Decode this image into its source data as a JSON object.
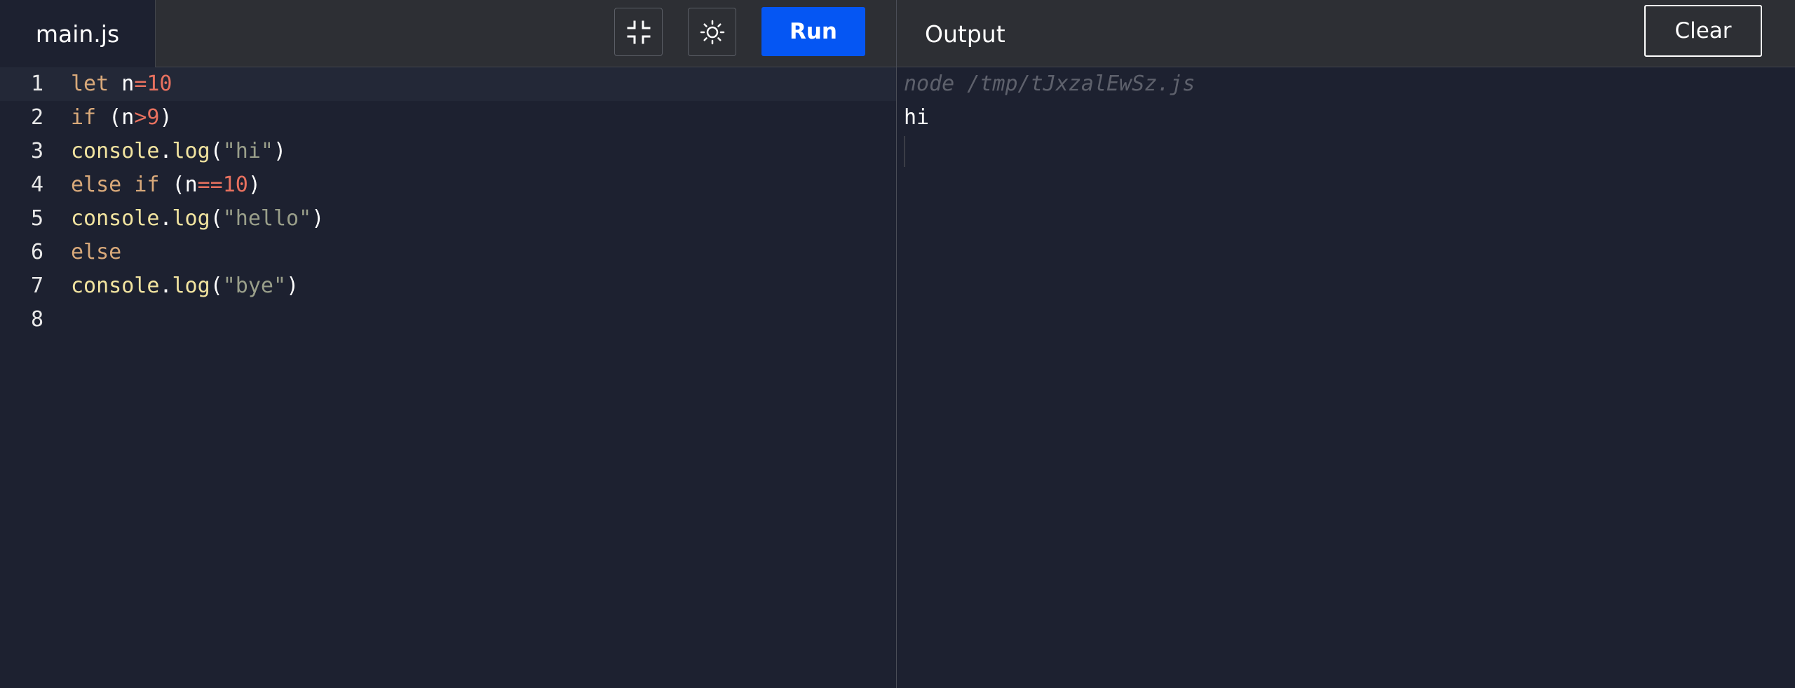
{
  "editor": {
    "file_tab": "main.js",
    "fullscreen_icon": "exit-fullscreen-icon",
    "theme_icon": "sun-icon",
    "run_label": "Run",
    "active_line": 1,
    "lines": [
      {
        "number": "1",
        "tokens": [
          {
            "t": "let",
            "c": "kw"
          },
          {
            "t": " ",
            "c": "var"
          },
          {
            "t": "n",
            "c": "var"
          },
          {
            "t": "=",
            "c": "op"
          },
          {
            "t": "10",
            "c": "num"
          }
        ]
      },
      {
        "number": "2",
        "tokens": [
          {
            "t": "if",
            "c": "kw"
          },
          {
            "t": " (",
            "c": "punc"
          },
          {
            "t": "n",
            "c": "var"
          },
          {
            "t": ">",
            "c": "op"
          },
          {
            "t": "9",
            "c": "num"
          },
          {
            "t": ")",
            "c": "punc"
          }
        ]
      },
      {
        "number": "3",
        "tokens": [
          {
            "t": "console",
            "c": "obj"
          },
          {
            "t": ".",
            "c": "punc"
          },
          {
            "t": "log",
            "c": "fn"
          },
          {
            "t": "(",
            "c": "punc"
          },
          {
            "t": "\"hi\"",
            "c": "str"
          },
          {
            "t": ")",
            "c": "punc"
          }
        ]
      },
      {
        "number": "4",
        "tokens": [
          {
            "t": "else",
            "c": "kw"
          },
          {
            "t": " ",
            "c": "var"
          },
          {
            "t": "if",
            "c": "kw"
          },
          {
            "t": " (",
            "c": "punc"
          },
          {
            "t": "n",
            "c": "var"
          },
          {
            "t": "==",
            "c": "op"
          },
          {
            "t": "10",
            "c": "num"
          },
          {
            "t": ")",
            "c": "punc"
          }
        ]
      },
      {
        "number": "5",
        "tokens": [
          {
            "t": "console",
            "c": "obj"
          },
          {
            "t": ".",
            "c": "punc"
          },
          {
            "t": "log",
            "c": "fn"
          },
          {
            "t": "(",
            "c": "punc"
          },
          {
            "t": "\"hello\"",
            "c": "str"
          },
          {
            "t": ")",
            "c": "punc"
          }
        ]
      },
      {
        "number": "6",
        "tokens": [
          {
            "t": "else",
            "c": "kw"
          }
        ]
      },
      {
        "number": "7",
        "tokens": [
          {
            "t": "console",
            "c": "obj"
          },
          {
            "t": ".",
            "c": "punc"
          },
          {
            "t": "log",
            "c": "fn"
          },
          {
            "t": "(",
            "c": "punc"
          },
          {
            "t": "\"bye\"",
            "c": "str"
          },
          {
            "t": ")",
            "c": "punc"
          }
        ]
      },
      {
        "number": "8",
        "tokens": []
      }
    ]
  },
  "output": {
    "title": "Output",
    "clear_label": "Clear",
    "command": "node /tmp/tJxzalEwSz.js",
    "result": "hi"
  },
  "colors": {
    "background": "#1d2130",
    "topbar": "#2d2f34",
    "run_button": "#0556f3"
  }
}
